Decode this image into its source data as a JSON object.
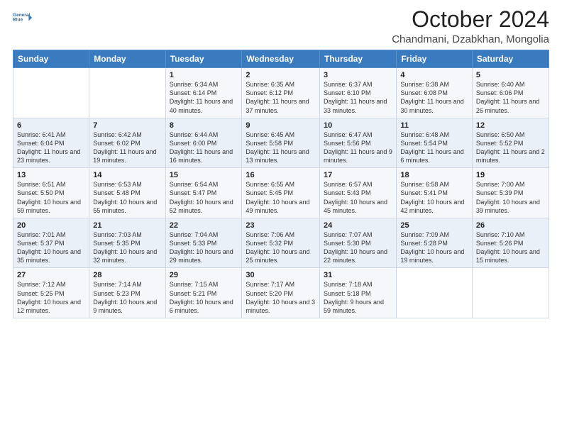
{
  "header": {
    "logo_line1": "General",
    "logo_line2": "Blue",
    "title": "October 2024",
    "subtitle": "Chandmani, Dzabkhan, Mongolia"
  },
  "columns": [
    "Sunday",
    "Monday",
    "Tuesday",
    "Wednesday",
    "Thursday",
    "Friday",
    "Saturday"
  ],
  "weeks": [
    [
      {
        "num": "",
        "info": ""
      },
      {
        "num": "",
        "info": ""
      },
      {
        "num": "1",
        "info": "Sunrise: 6:34 AM\nSunset: 6:14 PM\nDaylight: 11 hours and 40 minutes."
      },
      {
        "num": "2",
        "info": "Sunrise: 6:35 AM\nSunset: 6:12 PM\nDaylight: 11 hours and 37 minutes."
      },
      {
        "num": "3",
        "info": "Sunrise: 6:37 AM\nSunset: 6:10 PM\nDaylight: 11 hours and 33 minutes."
      },
      {
        "num": "4",
        "info": "Sunrise: 6:38 AM\nSunset: 6:08 PM\nDaylight: 11 hours and 30 minutes."
      },
      {
        "num": "5",
        "info": "Sunrise: 6:40 AM\nSunset: 6:06 PM\nDaylight: 11 hours and 26 minutes."
      }
    ],
    [
      {
        "num": "6",
        "info": "Sunrise: 6:41 AM\nSunset: 6:04 PM\nDaylight: 11 hours and 23 minutes."
      },
      {
        "num": "7",
        "info": "Sunrise: 6:42 AM\nSunset: 6:02 PM\nDaylight: 11 hours and 19 minutes."
      },
      {
        "num": "8",
        "info": "Sunrise: 6:44 AM\nSunset: 6:00 PM\nDaylight: 11 hours and 16 minutes."
      },
      {
        "num": "9",
        "info": "Sunrise: 6:45 AM\nSunset: 5:58 PM\nDaylight: 11 hours and 13 minutes."
      },
      {
        "num": "10",
        "info": "Sunrise: 6:47 AM\nSunset: 5:56 PM\nDaylight: 11 hours and 9 minutes."
      },
      {
        "num": "11",
        "info": "Sunrise: 6:48 AM\nSunset: 5:54 PM\nDaylight: 11 hours and 6 minutes."
      },
      {
        "num": "12",
        "info": "Sunrise: 6:50 AM\nSunset: 5:52 PM\nDaylight: 11 hours and 2 minutes."
      }
    ],
    [
      {
        "num": "13",
        "info": "Sunrise: 6:51 AM\nSunset: 5:50 PM\nDaylight: 10 hours and 59 minutes."
      },
      {
        "num": "14",
        "info": "Sunrise: 6:53 AM\nSunset: 5:48 PM\nDaylight: 10 hours and 55 minutes."
      },
      {
        "num": "15",
        "info": "Sunrise: 6:54 AM\nSunset: 5:47 PM\nDaylight: 10 hours and 52 minutes."
      },
      {
        "num": "16",
        "info": "Sunrise: 6:55 AM\nSunset: 5:45 PM\nDaylight: 10 hours and 49 minutes."
      },
      {
        "num": "17",
        "info": "Sunrise: 6:57 AM\nSunset: 5:43 PM\nDaylight: 10 hours and 45 minutes."
      },
      {
        "num": "18",
        "info": "Sunrise: 6:58 AM\nSunset: 5:41 PM\nDaylight: 10 hours and 42 minutes."
      },
      {
        "num": "19",
        "info": "Sunrise: 7:00 AM\nSunset: 5:39 PM\nDaylight: 10 hours and 39 minutes."
      }
    ],
    [
      {
        "num": "20",
        "info": "Sunrise: 7:01 AM\nSunset: 5:37 PM\nDaylight: 10 hours and 35 minutes."
      },
      {
        "num": "21",
        "info": "Sunrise: 7:03 AM\nSunset: 5:35 PM\nDaylight: 10 hours and 32 minutes."
      },
      {
        "num": "22",
        "info": "Sunrise: 7:04 AM\nSunset: 5:33 PM\nDaylight: 10 hours and 29 minutes."
      },
      {
        "num": "23",
        "info": "Sunrise: 7:06 AM\nSunset: 5:32 PM\nDaylight: 10 hours and 25 minutes."
      },
      {
        "num": "24",
        "info": "Sunrise: 7:07 AM\nSunset: 5:30 PM\nDaylight: 10 hours and 22 minutes."
      },
      {
        "num": "25",
        "info": "Sunrise: 7:09 AM\nSunset: 5:28 PM\nDaylight: 10 hours and 19 minutes."
      },
      {
        "num": "26",
        "info": "Sunrise: 7:10 AM\nSunset: 5:26 PM\nDaylight: 10 hours and 15 minutes."
      }
    ],
    [
      {
        "num": "27",
        "info": "Sunrise: 7:12 AM\nSunset: 5:25 PM\nDaylight: 10 hours and 12 minutes."
      },
      {
        "num": "28",
        "info": "Sunrise: 7:14 AM\nSunset: 5:23 PM\nDaylight: 10 hours and 9 minutes."
      },
      {
        "num": "29",
        "info": "Sunrise: 7:15 AM\nSunset: 5:21 PM\nDaylight: 10 hours and 6 minutes."
      },
      {
        "num": "30",
        "info": "Sunrise: 7:17 AM\nSunset: 5:20 PM\nDaylight: 10 hours and 3 minutes."
      },
      {
        "num": "31",
        "info": "Sunrise: 7:18 AM\nSunset: 5:18 PM\nDaylight: 9 hours and 59 minutes."
      },
      {
        "num": "",
        "info": ""
      },
      {
        "num": "",
        "info": ""
      }
    ]
  ]
}
